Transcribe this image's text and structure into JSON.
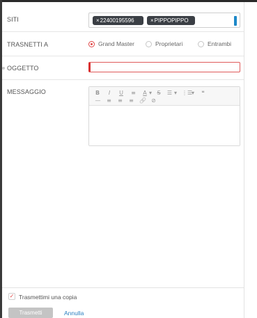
{
  "form": {
    "siti": {
      "label": "SITI",
      "tags": [
        {
          "remove": "×",
          "text": "22400195596"
        },
        {
          "remove": "×",
          "text": "PIPPOPIPPO"
        }
      ]
    },
    "trasmetti": {
      "label": "TRASNETTI A",
      "options": [
        {
          "label": "Grand Master",
          "selected": true
        },
        {
          "label": "Proprietari",
          "selected": false
        },
        {
          "label": "Entrambi",
          "selected": false
        }
      ]
    },
    "oggetto": {
      "label": "OGGETTO",
      "value": ""
    },
    "messaggio": {
      "label": "MESSAGGIO",
      "toolbar": {
        "bold": "B",
        "italic": "I",
        "underline": "U",
        "align": "≡",
        "font_color": "A",
        "caret": "▾",
        "strike": "S",
        "bullets": "☰",
        "numbered": "⋮☰",
        "quote": "❝",
        "hr": "—",
        "align_left": "≡",
        "align_center": "≡",
        "align_right": "≡",
        "link": "🔗",
        "unlink": "⊘"
      }
    }
  },
  "footer": {
    "copy_label": "Trasmettimi una copia",
    "copy_checked": true,
    "check_mark": "✓",
    "send_label": "Trasmetti",
    "cancel_label": "Annulla"
  },
  "colors": {
    "accent": "#e04848",
    "tag_bg": "#3b3f45",
    "link": "#2a7fc0",
    "disabled_button": "#c4c4c4"
  }
}
